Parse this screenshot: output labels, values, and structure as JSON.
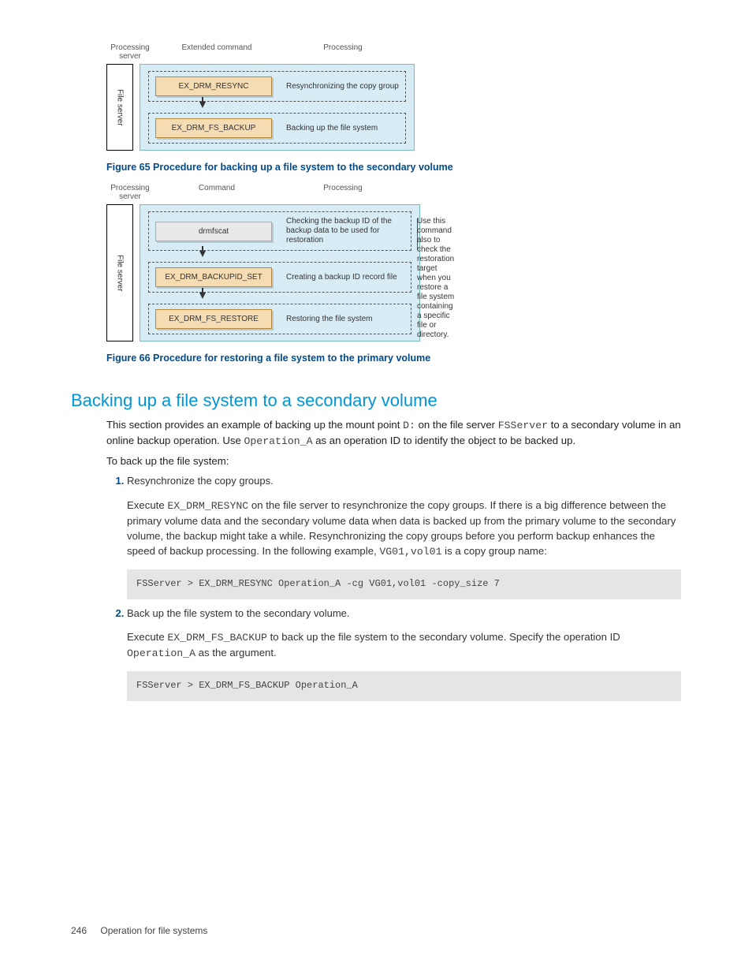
{
  "diagram1": {
    "headers": {
      "proc_server": "Processing\nserver",
      "cmd": "Extended command",
      "proc": "Processing"
    },
    "file_server_label": "File server",
    "steps": [
      {
        "cmd": "EX_DRM_RESYNC",
        "proc": "Resynchronizing the copy group"
      },
      {
        "cmd": "EX_DRM_FS_BACKUP",
        "proc": "Backing up the file system"
      }
    ]
  },
  "caption1": "Figure 65 Procedure for backing up a file system to the secondary volume",
  "diagram2": {
    "headers": {
      "proc_server": "Processing\nserver",
      "cmd": "Command",
      "proc": "Processing"
    },
    "file_server_label": "File server",
    "steps": [
      {
        "cmd": "drmfscat",
        "proc": "Checking the backup ID of the backup data to be used for restoration",
        "grey": true,
        "note": "Use this command also to check the restoration target when you restore a file system containing a specific file or directory."
      },
      {
        "cmd": "EX_DRM_BACKUPID_SET",
        "proc": "Creating a backup ID record file"
      },
      {
        "cmd": "EX_DRM_FS_RESTORE",
        "proc": "Restoring the file system"
      }
    ]
  },
  "caption2": "Figure 66 Procedure for restoring a file system to the primary volume",
  "section_heading": "Backing up a file system to a secondary volume",
  "intro": {
    "part1": "This section provides an example of backing up the mount point ",
    "mount": "D:",
    "part2": " on the file server ",
    "server": "FSServer",
    "part3": " to a secondary volume in an online backup operation. Use ",
    "opid": "Operation_A",
    "part4": " as an operation ID to identify the object to be backed up."
  },
  "lead": "To back up the file system:",
  "step1": {
    "title": "Resynchronize the copy groups.",
    "p1a": "Execute ",
    "cmd1": "EX_DRM_RESYNC",
    "p1b": " on the file server to resynchronize the copy groups. If there is a big difference between the primary volume data and the secondary volume data when data is backed up from the primary volume to the secondary volume, the backup might take a while. Resynchronizing the copy groups before you perform backup enhances the speed of backup processing. In the following example, ",
    "cg": "VG01,vol01",
    "p1c": " is a copy group name:",
    "code": "FSServer > EX_DRM_RESYNC Operation_A -cg VG01,vol01 -copy_size 7"
  },
  "step2": {
    "title": "Back up the file system to the secondary volume.",
    "p1a": "Execute ",
    "cmd1": "EX_DRM_FS_BACKUP",
    "p1b": " to back up the file system to the secondary volume. Specify the operation ID ",
    "opid": "Operation_A",
    "p1c": " as the argument.",
    "code": "FSServer > EX_DRM_FS_BACKUP Operation_A"
  },
  "footer": {
    "page": "246",
    "title": "Operation for file systems"
  }
}
